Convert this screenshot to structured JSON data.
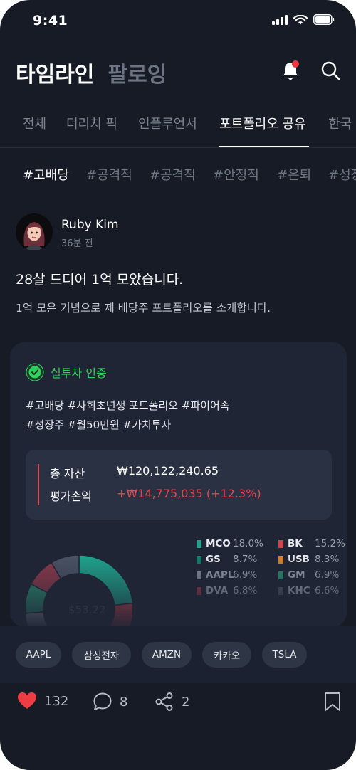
{
  "status": {
    "time": "9:41"
  },
  "header": {
    "title": "타임라인",
    "subtitle": "팔로잉"
  },
  "tabs": [
    {
      "label": "전체"
    },
    {
      "label": "더리치 픽"
    },
    {
      "label": "인플루언서"
    },
    {
      "label": "포트폴리오 공유",
      "active": true
    },
    {
      "label": "한국"
    }
  ],
  "hashtags": [
    {
      "label": "#고배당",
      "active": true
    },
    {
      "label": "#공격적"
    },
    {
      "label": "#공격적"
    },
    {
      "label": "#안정적"
    },
    {
      "label": "#은퇴"
    },
    {
      "label": "#성장"
    }
  ],
  "post": {
    "author": "Ruby Kim",
    "time_ago": "36분 전",
    "title": "28살 드디어 1억 모았습니다.",
    "body": "1억 모은 기념으로 제 배당주 포트폴리오를 소개합니다."
  },
  "portfolio": {
    "verified_label": "실투자 인증",
    "tags_line1": "#고배당  #사회초년생 포트폴리오  #파이어족",
    "tags_line2": "#성장주 #월50만원 #가치투자",
    "total_label": "총 자산",
    "total_value": "₩120,122,240.65",
    "pnl_label": "평가손익",
    "pnl_value": "+₩14,775,035 (+12.3%)",
    "pnl_color": "#e0484f",
    "center_label": "$53.22"
  },
  "chart_data": {
    "type": "pie",
    "categories": [
      "MCO",
      "BK",
      "GS",
      "USB",
      "AAPL",
      "GM",
      "DVA",
      "KHC"
    ],
    "values": [
      18.0,
      15.2,
      8.7,
      8.3,
      6.9,
      6.9,
      6.8,
      6.6
    ],
    "labels": [
      "18.0%",
      "15.2%",
      "8.7%",
      "8.3%",
      "6.9%",
      "6.9%",
      "6.8%",
      "6.6%"
    ],
    "colors": [
      "#1fa38c",
      "#d0424b",
      "#157a6a",
      "#d6842a",
      "#8a909c",
      "#2a8f72",
      "#8e3a4c",
      "#4a5264"
    ]
  },
  "stocks": [
    "AAPL",
    "삼성전자",
    "AMZN",
    "카카오",
    "TSLA"
  ],
  "actions": {
    "likes": "132",
    "comments": "8",
    "shares": "2"
  }
}
